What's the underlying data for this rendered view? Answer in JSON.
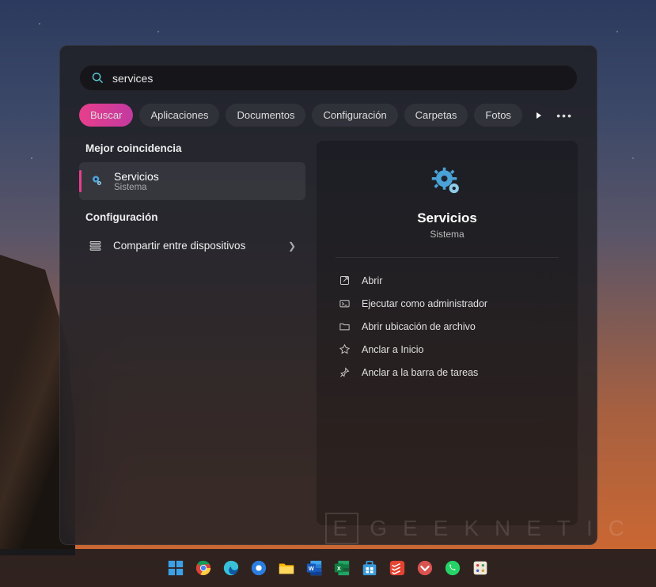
{
  "search": {
    "value": "services",
    "placeholder": ""
  },
  "tabs": [
    "Buscar",
    "Aplicaciones",
    "Documentos",
    "Configuración",
    "Carpetas",
    "Fotos"
  ],
  "activeTab": 0,
  "left": {
    "bestMatchHeader": "Mejor coincidencia",
    "match": {
      "title": "Servicios",
      "subtitle": "Sistema"
    },
    "configHeader": "Configuración",
    "configItem": "Compartir entre dispositivos"
  },
  "detail": {
    "title": "Servicios",
    "subtitle": "Sistema",
    "actions": [
      "Abrir",
      "Ejecutar como administrador",
      "Abrir ubicación de archivo",
      "Anclar a Inicio",
      "Anclar a la barra de tareas"
    ]
  },
  "watermark": {
    "box": "E",
    "text": "GEEKNETIC"
  },
  "taskbar": [
    "start",
    "chrome",
    "edge",
    "web",
    "explorer",
    "word",
    "excel",
    "store",
    "todoist",
    "pocket",
    "whatsapp",
    "tweaks"
  ]
}
